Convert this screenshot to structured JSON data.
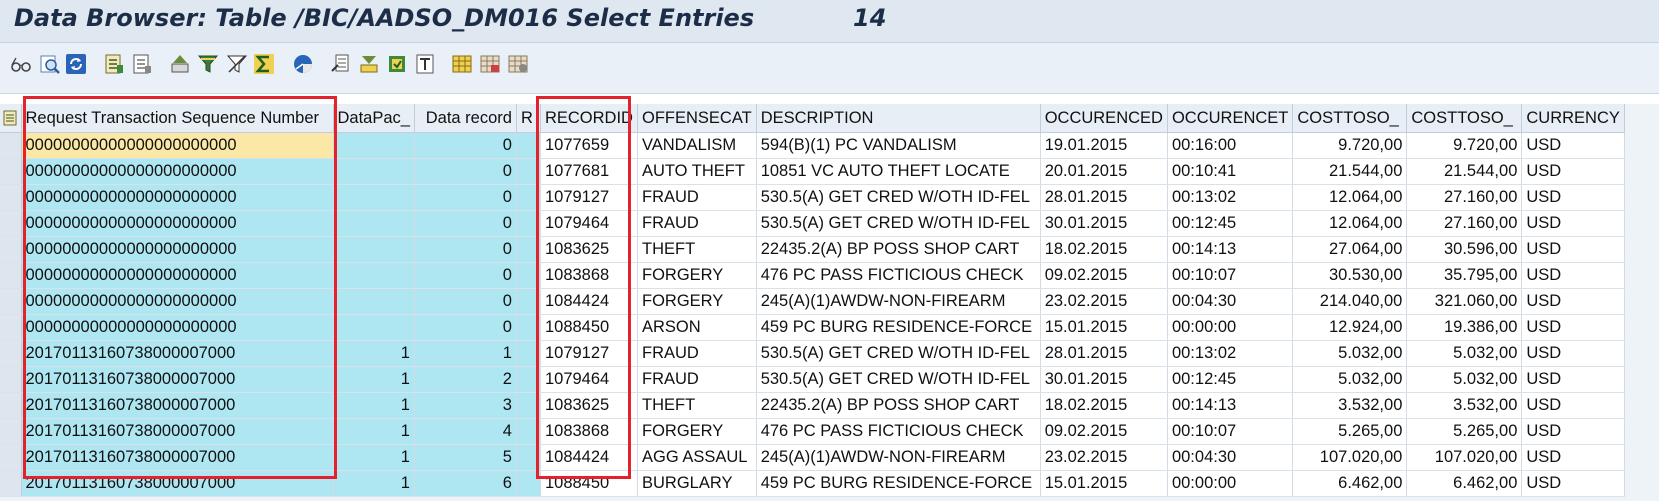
{
  "window": {
    "title": "Data Browser: Table /BIC/AADSO_DM016 Select Entries",
    "entry_count": "14"
  },
  "toolbar": {
    "icons": [
      "glasses-icon",
      "detail-view-icon",
      "refresh-icon",
      "check-table-icon",
      "choose-icon",
      "print-icon",
      "filter-icon",
      "delete-filter-icon",
      "sum-icon",
      "abc-analysis-icon",
      "export-icon",
      "download-icon",
      "local-file-icon",
      "word-processing-icon",
      "layout-choose-icon",
      "layout-save-icon",
      "layout-change-icon"
    ]
  },
  "table": {
    "columns": [
      "Request Transaction Sequence Number",
      "DataPac_",
      "Data record",
      "R",
      "RECORDID",
      "OFFENSECAT",
      "DESCRIPTION",
      "OCCURENCED",
      "OCCURENCET",
      "COSTTOSO_",
      "COSTTOSO_",
      "CURRENCY"
    ],
    "rows": [
      [
        "00000000000000000000000",
        "",
        "0",
        "",
        "1077659",
        "VANDALISM",
        "594(B)(1) PC VANDALISM",
        "19.01.2015",
        "00:16:00",
        "9.720,00",
        "9.720,00",
        "USD"
      ],
      [
        "00000000000000000000000",
        "",
        "0",
        "",
        "1077681",
        "AUTO THEFT",
        "10851 VC AUTO THEFT LOCATE",
        "20.01.2015",
        "00:10:41",
        "21.544,00",
        "21.544,00",
        "USD"
      ],
      [
        "00000000000000000000000",
        "",
        "0",
        "",
        "1079127",
        "FRAUD",
        "530.5(A) GET CRED W/OTH ID-FEL",
        "28.01.2015",
        "00:13:02",
        "12.064,00",
        "27.160,00",
        "USD"
      ],
      [
        "00000000000000000000000",
        "",
        "0",
        "",
        "1079464",
        "FRAUD",
        "530.5(A) GET CRED W/OTH ID-FEL",
        "30.01.2015",
        "00:12:45",
        "12.064,00",
        "27.160,00",
        "USD"
      ],
      [
        "00000000000000000000000",
        "",
        "0",
        "",
        "1083625",
        "THEFT",
        "22435.2(A) BP POSS SHOP CART",
        "18.02.2015",
        "00:14:13",
        "27.064,00",
        "30.596,00",
        "USD"
      ],
      [
        "00000000000000000000000",
        "",
        "0",
        "",
        "1083868",
        "FORGERY",
        "476 PC PASS FICTICIOUS CHECK",
        "09.02.2015",
        "00:10:07",
        "30.530,00",
        "35.795,00",
        "USD"
      ],
      [
        "00000000000000000000000",
        "",
        "0",
        "",
        "1084424",
        "FORGERY",
        "245(A)(1)AWDW-NON-FIREARM",
        "23.02.2015",
        "00:04:30",
        "214.040,00",
        "321.060,00",
        "USD"
      ],
      [
        "00000000000000000000000",
        "",
        "0",
        "",
        "1088450",
        "ARSON",
        "459 PC BURG RESIDENCE-FORCE",
        "15.01.2015",
        "00:00:00",
        "12.924,00",
        "19.386,00",
        "USD"
      ],
      [
        "20170113160738000007000",
        "1",
        "1",
        "",
        "1079127",
        "FRAUD",
        "530.5(A) GET CRED W/OTH ID-FEL",
        "28.01.2015",
        "00:13:02",
        "5.032,00",
        "5.032,00",
        "USD"
      ],
      [
        "20170113160738000007000",
        "1",
        "2",
        "",
        "1079464",
        "FRAUD",
        "530.5(A) GET CRED W/OTH ID-FEL",
        "30.01.2015",
        "00:12:45",
        "5.032,00",
        "5.032,00",
        "USD"
      ],
      [
        "20170113160738000007000",
        "1",
        "3",
        "",
        "1083625",
        "THEFT",
        "22435.2(A) BP POSS SHOP CART",
        "18.02.2015",
        "00:14:13",
        "3.532,00",
        "3.532,00",
        "USD"
      ],
      [
        "20170113160738000007000",
        "1",
        "4",
        "",
        "1083868",
        "FORGERY",
        "476 PC PASS FICTICIOUS CHECK",
        "09.02.2015",
        "00:10:07",
        "5.265,00",
        "5.265,00",
        "USD"
      ],
      [
        "20170113160738000007000",
        "1",
        "5",
        "",
        "1084424",
        "AGG ASSAUL",
        "245(A)(1)AWDW-NON-FIREARM",
        "23.02.2015",
        "00:04:30",
        "107.020,00",
        "107.020,00",
        "USD"
      ],
      [
        "20170113160738000007000",
        "1",
        "6",
        "",
        "1088450",
        "BURGLARY",
        "459 PC BURG RESIDENCE-FORCE",
        "15.01.2015",
        "00:00:00",
        "6.462,00",
        "6.462,00",
        "USD"
      ]
    ]
  },
  "colors": {
    "key_column_bg": "#aee6f2",
    "highlight_border": "#e3222c",
    "current_cell_bg": "#fbe8a6"
  }
}
